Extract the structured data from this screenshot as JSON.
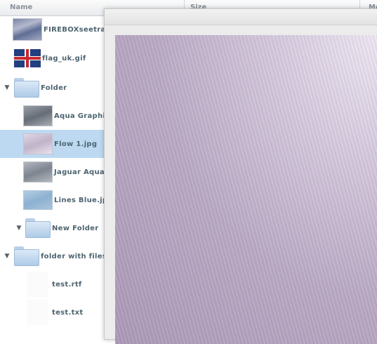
{
  "columns": {
    "name": "Name",
    "size": "Size",
    "modified": "Mo"
  },
  "rows": [
    {
      "label": "FIREBOXseetra"
    },
    {
      "label": "flag_uk.gif"
    },
    {
      "label": "Folder"
    },
    {
      "label": "Aqua Graphit"
    },
    {
      "label": "Flow 1.jpg",
      "selected": true
    },
    {
      "label": "Jaguar Aqua"
    },
    {
      "label": "Lines Blue.jp"
    },
    {
      "label": "New Folder"
    },
    {
      "label": "folder with files"
    },
    {
      "label": "test.rtf"
    },
    {
      "label": "test.txt"
    }
  ],
  "preview": {
    "image_name": "Flow 1.jpg"
  },
  "colors": {
    "selection": "#bcd9f1",
    "label_text": "#4d6470"
  }
}
